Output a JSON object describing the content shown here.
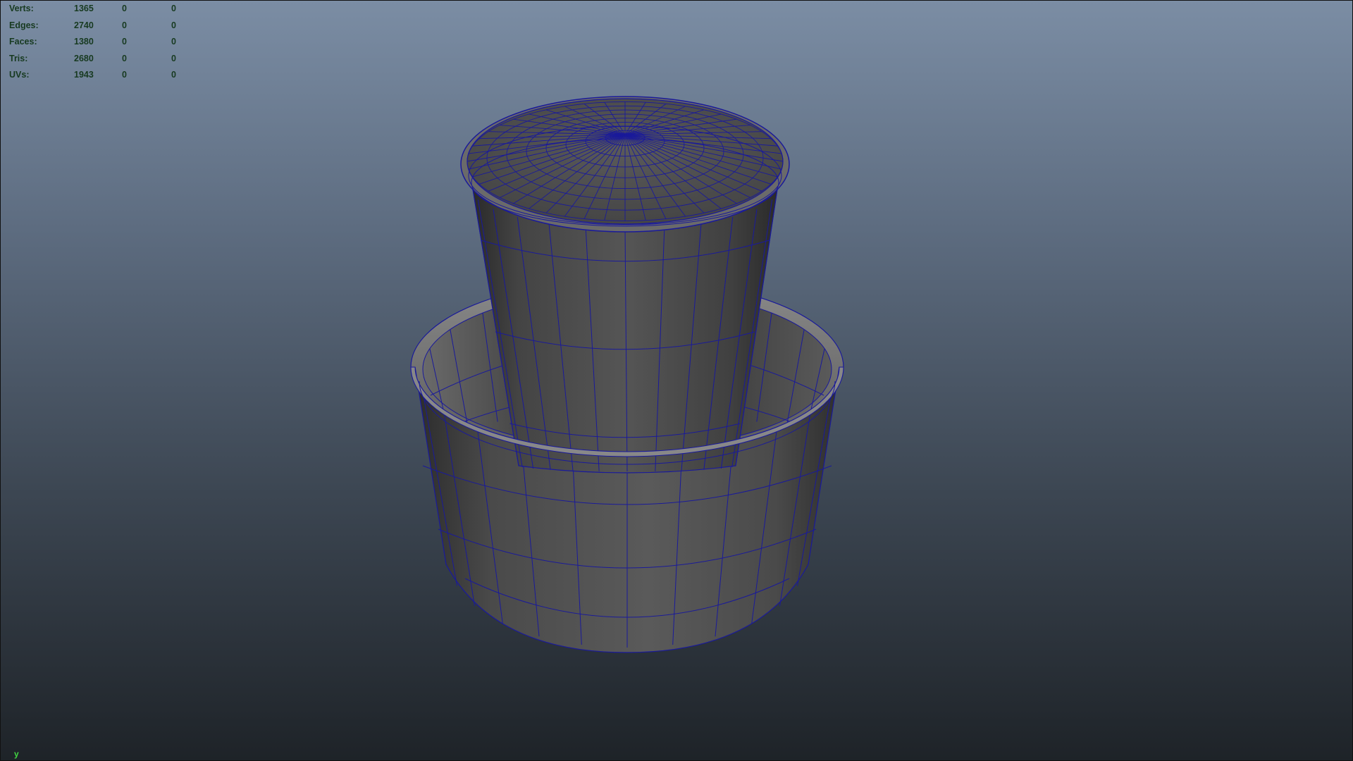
{
  "hud": {
    "rows": [
      {
        "label": "Verts:",
        "v1": "1365",
        "v2": "0",
        "v3": "0"
      },
      {
        "label": "Edges:",
        "v1": "2740",
        "v2": "0",
        "v3": "0"
      },
      {
        "label": "Faces:",
        "v1": "1380",
        "v2": "0",
        "v3": "0"
      },
      {
        "label": "Tris:",
        "v1": "2680",
        "v2": "0",
        "v3": "0"
      },
      {
        "label": "UVs:",
        "v1": "1943",
        "v2": "0",
        "v3": "0"
      }
    ]
  },
  "axis": {
    "label": "y"
  },
  "colors": {
    "wireframe": "#1a1a9a",
    "mesh_gray": "#4e4e4e",
    "hud_text": "#173a20",
    "axis_text": "#42d642"
  }
}
